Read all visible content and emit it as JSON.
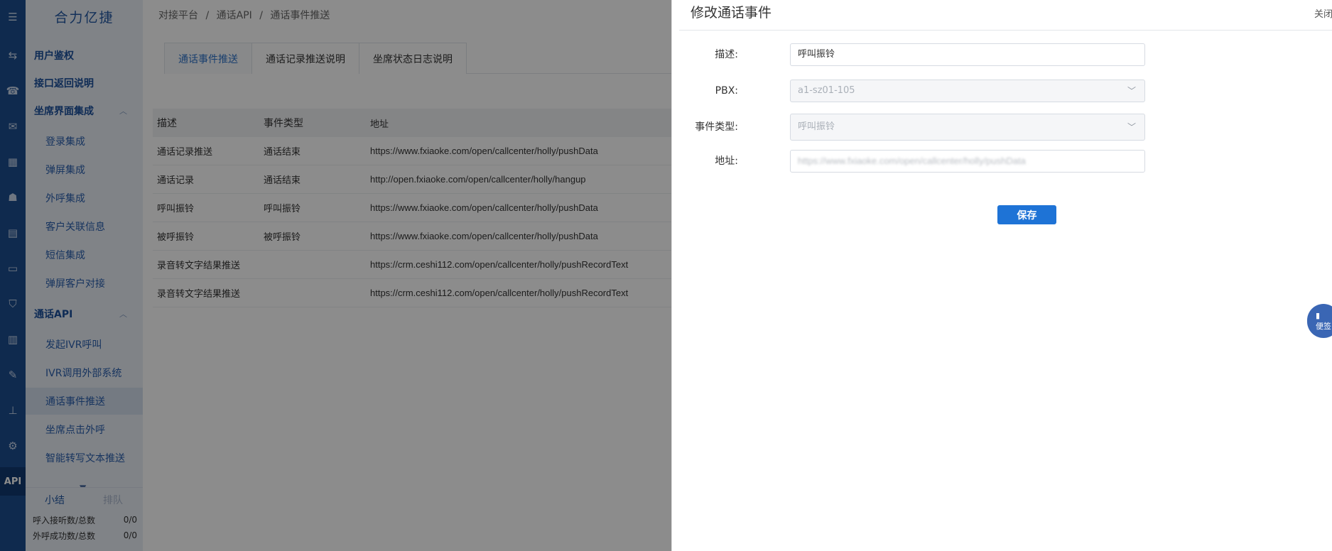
{
  "brand": "合力亿捷",
  "rail": {
    "icons": [
      "menu-icon",
      "transfer-icon",
      "phone-icon",
      "chat-icon",
      "grid-icon",
      "user-icon",
      "clipboard-icon",
      "monitor-icon",
      "shield-icon",
      "bar-chart-icon",
      "message-icon",
      "org-chart-icon",
      "gear-icon"
    ],
    "api_label": "API"
  },
  "menu": {
    "items": [
      {
        "label": "用户鉴权"
      },
      {
        "label": "接口返回说明"
      },
      {
        "label": "坐席界面集成"
      },
      {
        "label": "登录集成"
      },
      {
        "label": "弹屏集成"
      },
      {
        "label": "外呼集成"
      },
      {
        "label": "客户关联信息"
      },
      {
        "label": "短信集成"
      },
      {
        "label": "弹屏客户对接"
      },
      {
        "label": "通话API"
      },
      {
        "label": "发起IVR呼叫"
      },
      {
        "label": "IVR调用外部系统"
      },
      {
        "label": "通话事件推送"
      },
      {
        "label": "坐席点击外呼"
      },
      {
        "label": "智能转写文本推送"
      }
    ],
    "caret_up": "︿"
  },
  "stats": {
    "tab_summary": "小结",
    "tab_queue": "排队",
    "rows": [
      {
        "label": "呼入接听数/总数",
        "value": "0/0"
      },
      {
        "label": "外呼成功数/总数",
        "value": "0/0"
      }
    ]
  },
  "breadcrumb": {
    "items": [
      "对接平台",
      "通话API",
      "通话事件推送"
    ],
    "separator": "/"
  },
  "tabs": [
    {
      "label": "通话事件推送",
      "active": true
    },
    {
      "label": "通话记录推送说明",
      "active": false
    },
    {
      "label": "坐席状态日志说明",
      "active": false
    }
  ],
  "table": {
    "headers": [
      "描述",
      "事件类型",
      "地址"
    ],
    "rows": [
      {
        "desc": "通话记录推送",
        "type": "通话结束",
        "url": "https://www.fxiaoke.com/open/callcenter/holly/pushData"
      },
      {
        "desc": "通话记录",
        "type": "通话结束",
        "url": "http://open.fxiaoke.com/open/callcenter/holly/hangup"
      },
      {
        "desc": "呼叫振铃",
        "type": "呼叫振铃",
        "url": "https://www.fxiaoke.com/open/callcenter/holly/pushData"
      },
      {
        "desc": "被呼振铃",
        "type": "被呼振铃",
        "url": "https://www.fxiaoke.com/open/callcenter/holly/pushData"
      },
      {
        "desc": "录音转文字结果推送",
        "type": "",
        "url": "https://crm.ceshi112.com/open/callcenter/holly/pushRecordText"
      },
      {
        "desc": "录音转文字结果推送",
        "type": "",
        "url": "https://crm.ceshi112.com/open/callcenter/holly/pushRecordText"
      }
    ]
  },
  "drawer": {
    "title": "修改通话事件",
    "close_label": "关闭",
    "fields": {
      "desc_label": "描述:",
      "desc_value": "呼叫振铃",
      "pbx_label": "PBX:",
      "pbx_value": "a1-sz01-105",
      "event_label": "事件类型:",
      "event_value": "呼叫振铃",
      "addr_label": "地址:",
      "addr_value": "https://www.fxiaoke.com/open/callcenter/holly/pushData"
    },
    "save_label": "保存"
  },
  "float_note": {
    "label": "便签"
  },
  "colors": {
    "rail": "#1d4d8f",
    "accent": "#1e73d6",
    "menu_bg": "#e9eef6"
  }
}
